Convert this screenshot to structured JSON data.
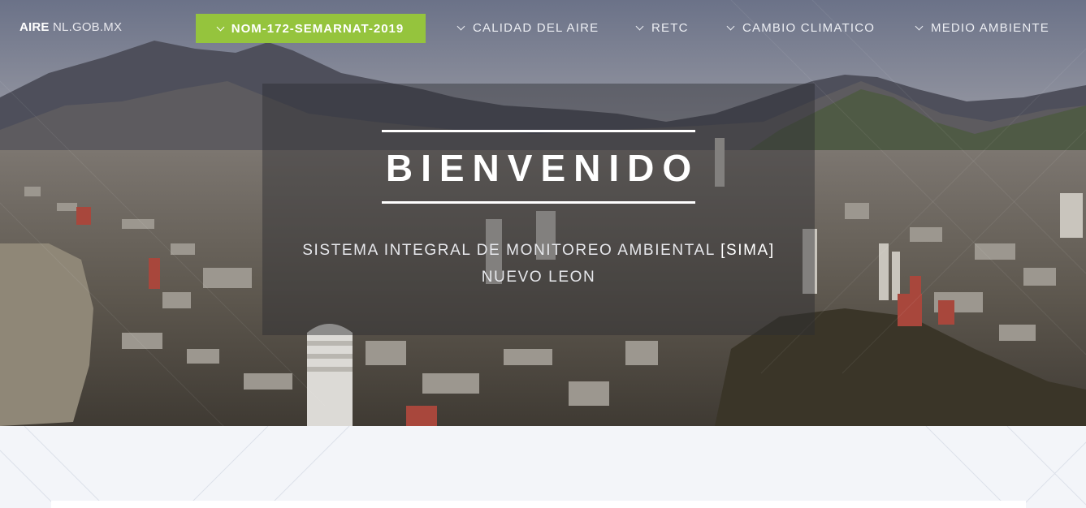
{
  "brand": {
    "bold": "AIRE",
    "rest": " NL.GOB.MX"
  },
  "nav": {
    "cta_label": "NOM-172-SEMARNAT-2019",
    "items": [
      {
        "label": "CALIDAD DEL AIRE"
      },
      {
        "label": "RETC"
      },
      {
        "label": "CAMBIO CLIMATICO"
      },
      {
        "label": "MEDIO AMBIENTE"
      }
    ],
    "icon": "chevron-down-icon"
  },
  "hero": {
    "title": "BIENVENIDO",
    "subtitle_prefix": "SISTEMA INTEGRAL DE MONITOREO AMBIENTAL ",
    "subtitle_highlight": "[SIMA]",
    "subtitle_line2": "NUEVO LEON"
  },
  "colors": {
    "accent_green": "#95c43d",
    "page_background": "#f3f5f9",
    "panel_overlay": "rgba(45,45,48,0.45)"
  }
}
